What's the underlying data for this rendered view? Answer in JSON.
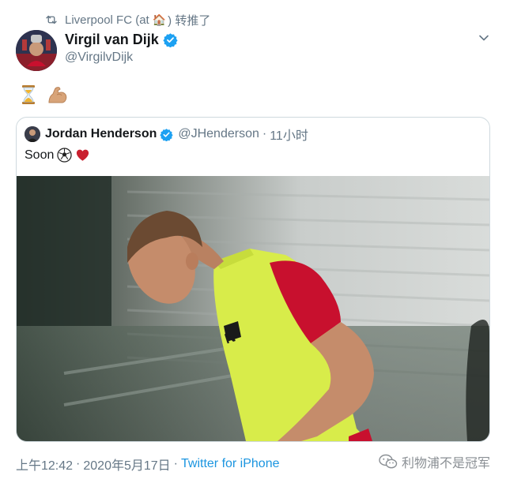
{
  "retweet": {
    "text": "Liverpool FC (at",
    "house_emoji": "🏠",
    "suffix": ") 转推了"
  },
  "tweet": {
    "display_name": "Virgil van Dijk",
    "handle": "@VirgilvDijk",
    "emojis": [
      "hourglass-icon",
      "flexed-biceps-icon"
    ]
  },
  "quoted": {
    "display_name": "Jordan Henderson",
    "handle": "@JHenderson",
    "dot": "·",
    "time": "11小时",
    "text": "Soon"
  },
  "footer": {
    "time": "上午12:42",
    "sep1": "·",
    "date": "2020年5月17日",
    "sep2": "·",
    "source": "Twitter for iPhone"
  },
  "watermark": {
    "text": "利物浦不是冠军"
  },
  "colors": {
    "twitter_blue": "#1da1f2",
    "secondary_text": "#657786",
    "kit_yellow": "#d8ec4a",
    "kit_red": "#c8102e"
  }
}
